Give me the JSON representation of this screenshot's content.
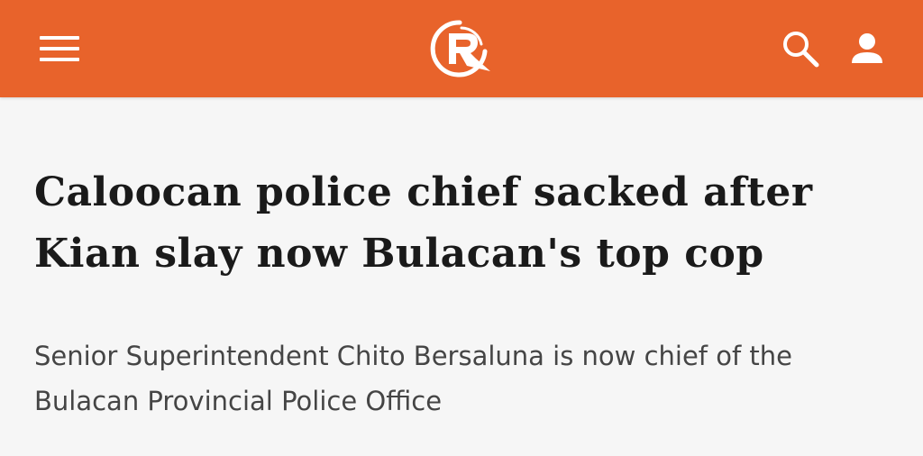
{
  "header": {
    "background_color": "#e8632b",
    "menu_icon": "hamburger-menu-icon",
    "logo_icon": "rappler-logo-icon",
    "search_icon": "search-icon",
    "account_icon": "user-account-icon"
  },
  "article": {
    "headline": "Caloocan police chief sacked after Kian slay now Bulacan's top cop",
    "summary": "Senior Superintendent Chito Bersaluna is now chief of the Bulacan Provincial Police Office"
  }
}
